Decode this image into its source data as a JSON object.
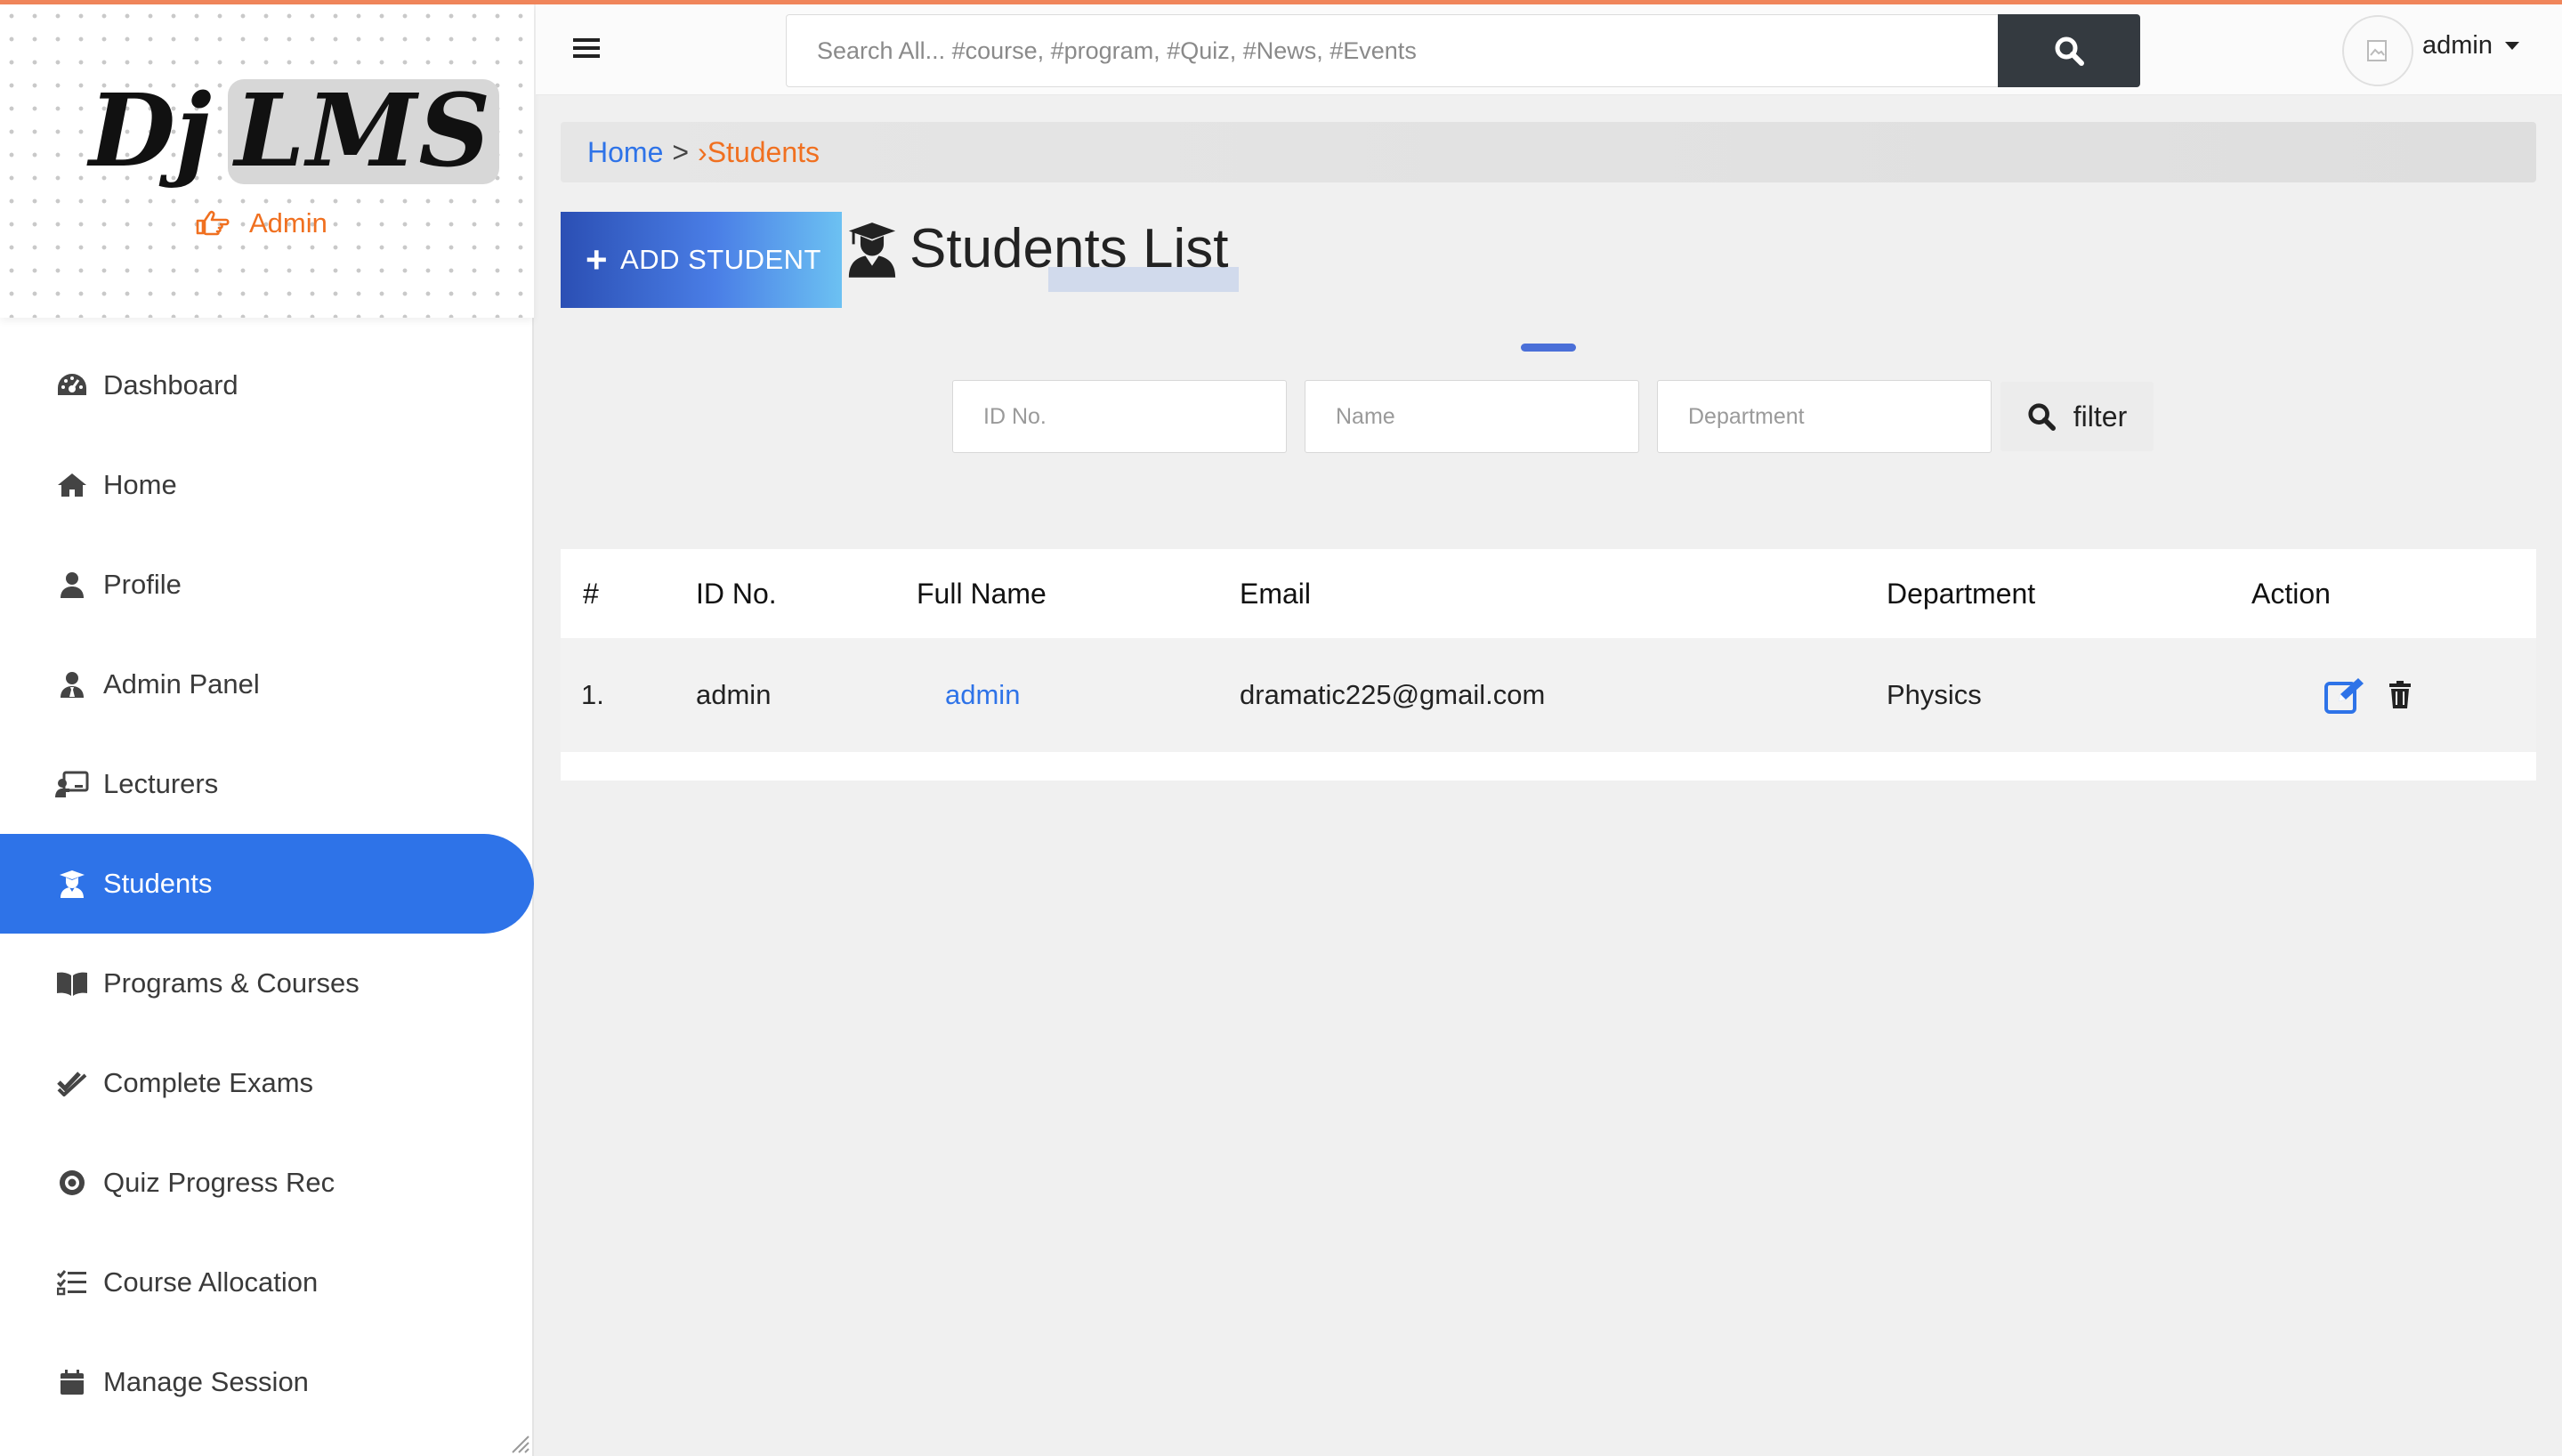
{
  "brand": {
    "logo_left": "Dj",
    "logo_right": "LMS",
    "role": "Admin"
  },
  "sidebar": {
    "items": [
      {
        "label": "Dashboard",
        "icon": "dashboard-gauge-icon"
      },
      {
        "label": "Home",
        "icon": "home-icon"
      },
      {
        "label": "Profile",
        "icon": "user-icon"
      },
      {
        "label": "Admin Panel",
        "icon": "user-tie-icon"
      },
      {
        "label": "Lecturers",
        "icon": "chalkboard-teacher-icon"
      },
      {
        "label": "Students",
        "icon": "user-graduate-icon",
        "active": true
      },
      {
        "label": "Programs & Courses",
        "icon": "book-open-icon"
      },
      {
        "label": "Complete Exams",
        "icon": "check-double-icon"
      },
      {
        "label": "Quiz Progress Rec",
        "icon": "record-icon"
      },
      {
        "label": "Course Allocation",
        "icon": "tasks-icon"
      },
      {
        "label": "Manage Session",
        "icon": "calendar-icon"
      }
    ]
  },
  "topbar": {
    "search_placeholder": "Search All... #course, #program, #Quiz, #News, #Events",
    "user_name": "admin"
  },
  "breadcrumb": {
    "home": "Home",
    "separator": ">",
    "current": "›Students"
  },
  "main": {
    "add_button": "ADD STUDENT",
    "title": "Students List",
    "filters": {
      "id_placeholder": "ID No.",
      "name_placeholder": "Name",
      "department_placeholder": "Department",
      "button": "filter"
    }
  },
  "table": {
    "headers": [
      "#",
      "ID No.",
      "Full Name",
      "Email",
      "Department",
      "Action"
    ],
    "rows": [
      {
        "num": "1.",
        "id": "admin",
        "full_name": "admin",
        "email": "dramatic225@gmail.com",
        "department": "Physics"
      }
    ]
  },
  "colors": {
    "accent": "#2e73e8",
    "orange": "#f07020",
    "search_button": "#343a40"
  }
}
